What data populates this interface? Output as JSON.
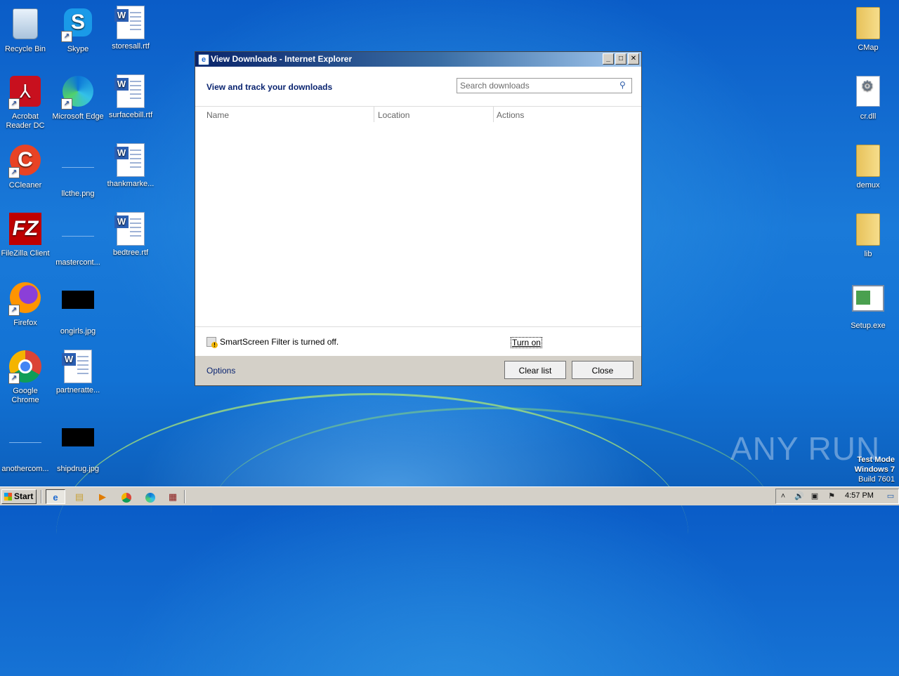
{
  "desktop": {
    "icons_left": [
      {
        "label": "Recycle Bin",
        "icon": "recycle-bin-icon"
      },
      {
        "label": "Skype",
        "icon": "skype-icon"
      },
      {
        "label": "storesall.rtf",
        "icon": "word-document-icon"
      },
      {
        "label": "Acrobat Reader DC",
        "icon": "acrobat-reader-icon"
      },
      {
        "label": "Microsoft Edge",
        "icon": "edge-icon"
      },
      {
        "label": "surfacebill.rtf",
        "icon": "word-document-icon"
      },
      {
        "label": "CCleaner",
        "icon": "ccleaner-icon"
      },
      {
        "label": "llcthe.png",
        "icon": "image-file-icon"
      },
      {
        "label": "thankmarke...",
        "icon": "word-document-icon"
      },
      {
        "label": "FileZilla Client",
        "icon": "filezilla-icon"
      },
      {
        "label": "mastercont...",
        "icon": "image-file-icon"
      },
      {
        "label": "bedtree.rtf",
        "icon": "word-document-icon"
      },
      {
        "label": "Firefox",
        "icon": "firefox-icon"
      },
      {
        "label": "ongirls.jpg",
        "icon": "image-file-icon"
      },
      {
        "label": "Google Chrome",
        "icon": "chrome-icon"
      },
      {
        "label": "partneratte...",
        "icon": "word-document-icon"
      },
      {
        "label": "anothercom...",
        "icon": "image-file-icon"
      },
      {
        "label": "shipdrug.jpg",
        "icon": "image-file-icon"
      }
    ],
    "icons_right": [
      {
        "label": "CMap",
        "icon": "folder-icon"
      },
      {
        "label": "cr.dll",
        "icon": "dll-file-icon"
      },
      {
        "label": "demux",
        "icon": "folder-icon"
      },
      {
        "label": "lib",
        "icon": "folder-icon"
      },
      {
        "label": "Setup.exe",
        "icon": "setup-exe-icon"
      }
    ]
  },
  "dialog": {
    "title": "View Downloads - Internet Explorer",
    "header": "View and track your downloads",
    "search": {
      "placeholder": "Search downloads",
      "value": ""
    },
    "columns": {
      "name": "Name",
      "location": "Location",
      "actions": "Actions"
    },
    "smartscreen_text": "SmartScreen Filter is turned off.",
    "turn_on": "Turn on",
    "options": "Options",
    "clear_list": "Clear list",
    "close": "Close"
  },
  "watermark": "ANY RUN",
  "test_mode": {
    "line1": "Test Mode",
    "line2": "Windows 7",
    "line3": "Build 7601"
  },
  "taskbar": {
    "start": "Start",
    "clock": "4:57 PM"
  },
  "colors": {
    "titlebar_start": "#0a246a",
    "desktop": "#1272d4",
    "taskbar": "#d4d0c8"
  }
}
